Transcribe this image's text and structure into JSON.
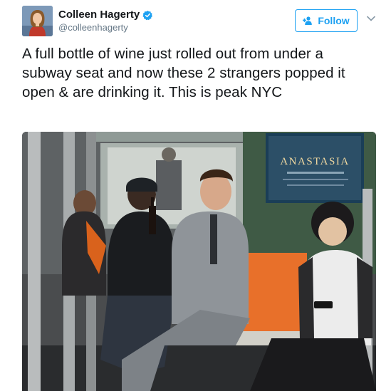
{
  "author": {
    "display_name": "Colleen Hagerty",
    "handle": "@colleenhagerty",
    "verified": true,
    "avatar_icon": "profile-photo-icon"
  },
  "actions": {
    "follow_label": "Follow",
    "follow_icon": "add-user-icon",
    "menu_icon": "chevron-down-icon"
  },
  "tweet": {
    "text": "A full bottle of wine just rolled out from under a subway seat and now these 2 strangers popped it open & are drinking it. This is peak NYC"
  },
  "media": {
    "poster_title": "ANASTASIA"
  },
  "colors": {
    "accent": "#1da1f2",
    "text": "#14171a",
    "secondary": "#657786"
  }
}
